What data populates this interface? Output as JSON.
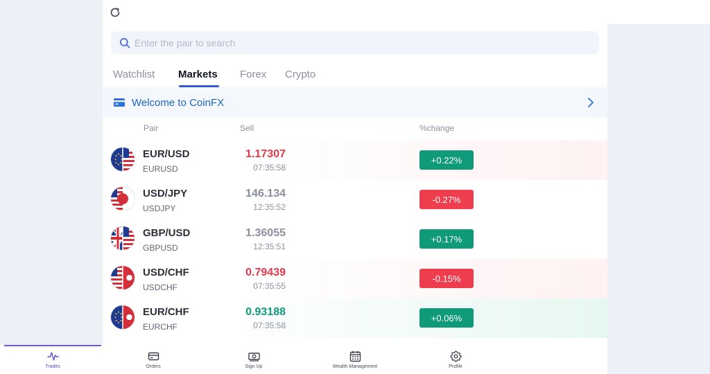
{
  "search": {
    "placeholder": "Enter the pair to search"
  },
  "tabs": [
    {
      "label": "Watchlist",
      "active": false
    },
    {
      "label": "Markets",
      "active": true
    },
    {
      "label": "Forex",
      "active": false
    },
    {
      "label": "Crypto",
      "active": false
    }
  ],
  "banner": {
    "text": "Welcome to CoinFX"
  },
  "table": {
    "headers": {
      "pair": "Pair",
      "sell": "Sell",
      "change": "%change"
    },
    "rows": [
      {
        "pair": "EUR/USD",
        "code": "EURUSD",
        "price": "1.17307",
        "price_color": "#e0394a",
        "time": "07:35:58",
        "change": "+0.22%",
        "change_color": "#0f9a7a",
        "flag": "eu-us-flag"
      },
      {
        "pair": "USD/JPY",
        "code": "USDJPY",
        "price": "146.134",
        "price_color": "#8a8f9c",
        "time": "12:35:52",
        "change": "-0.27%",
        "change_color": "#ee3d4c",
        "flag": "us-jp-flag"
      },
      {
        "pair": "GBP/USD",
        "code": "GBPUSD",
        "price": "1.36055",
        "price_color": "#8a8f9c",
        "time": "12:35:51",
        "change": "+0.17%",
        "change_color": "#0f9a7a",
        "flag": "gb-us-flag"
      },
      {
        "pair": "USD/CHF",
        "code": "USDCHF",
        "price": "0.79439",
        "price_color": "#e0394a",
        "time": "07:35:55",
        "change": "-0.15%",
        "change_color": "#ee3d4c",
        "flag": "us-ch-flag"
      },
      {
        "pair": "EUR/CHF",
        "code": "EURCHF",
        "price": "0.93188",
        "price_color": "#0f9a7a",
        "time": "07:35:58",
        "change": "+0.06%",
        "change_color": "#0f9a7a",
        "flag": "eu-ch-flag"
      }
    ]
  },
  "nav": [
    {
      "label": "Trades",
      "icon": "pulse-icon",
      "active": true
    },
    {
      "label": "Orders",
      "icon": "card-icon",
      "active": false
    },
    {
      "label": "Sign Up",
      "icon": "cash-icon",
      "active": false
    },
    {
      "label": "Wealth Management",
      "icon": "calendar-icon",
      "active": false
    },
    {
      "label": "Profile",
      "icon": "gear-icon",
      "active": false
    }
  ],
  "colors": {
    "accent": "#3557d8",
    "link": "#1d64c8",
    "up": "#0f9a7a",
    "down": "#ee3d4c",
    "nav_active": "#6b5bd6"
  }
}
